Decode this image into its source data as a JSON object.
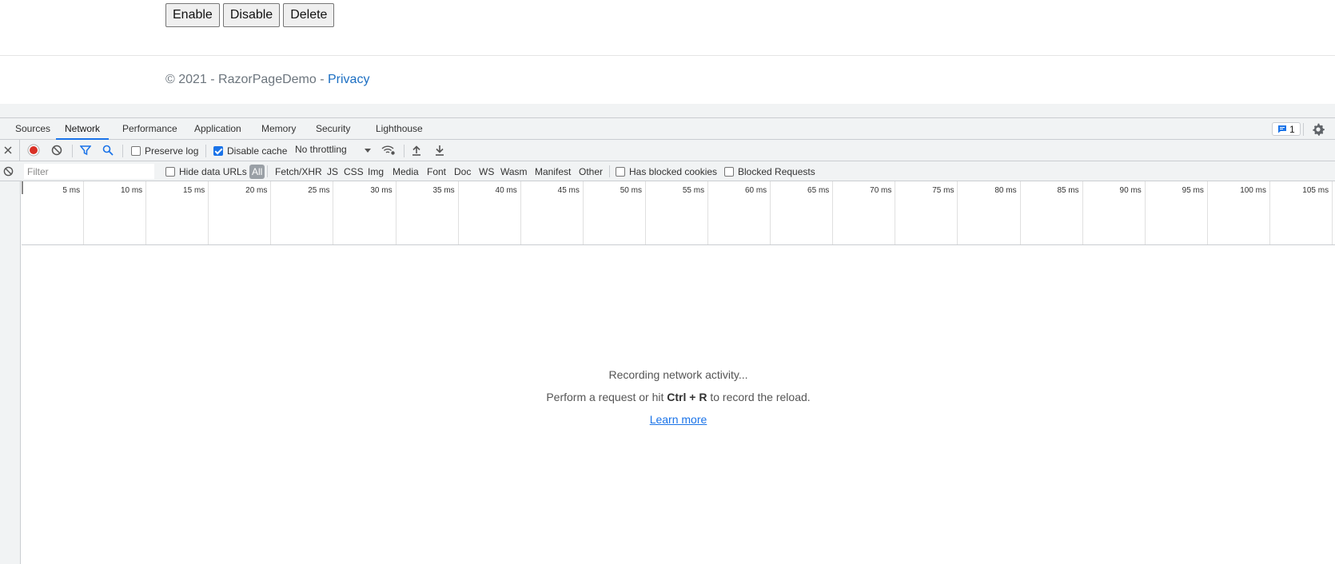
{
  "page": {
    "buttons": [
      "Enable",
      "Disable",
      "Delete"
    ],
    "footer": {
      "copyright": "© 2021 - RazorPageDemo - ",
      "privacy_link": "Privacy"
    }
  },
  "devtools": {
    "tabs": [
      {
        "label": "Sources",
        "active": false
      },
      {
        "label": "Network",
        "active": true
      },
      {
        "label": "Performance",
        "active": false
      },
      {
        "label": "Application",
        "active": false
      },
      {
        "label": "Memory",
        "active": false
      },
      {
        "label": "Security",
        "active": false
      },
      {
        "label": "Lighthouse",
        "active": false
      }
    ],
    "issues_count": "1",
    "toolbar": {
      "preserve_log": {
        "label": "Preserve log",
        "checked": false
      },
      "disable_cache": {
        "label": "Disable cache",
        "checked": true
      },
      "throttling": "No throttling"
    },
    "filter": {
      "placeholder": "Filter",
      "hide_data_urls": {
        "label": "Hide data URLs",
        "checked": false
      },
      "types": [
        "All",
        "Fetch/XHR",
        "JS",
        "CSS",
        "Img",
        "Media",
        "Font",
        "Doc",
        "WS",
        "Wasm",
        "Manifest",
        "Other"
      ],
      "selected_type": "All",
      "has_blocked_cookies": {
        "label": "Has blocked cookies",
        "checked": false
      },
      "blocked_requests": {
        "label": "Blocked Requests",
        "checked": false
      }
    },
    "timeline_ticks": [
      "5 ms",
      "10 ms",
      "15 ms",
      "20 ms",
      "25 ms",
      "30 ms",
      "35 ms",
      "40 ms",
      "45 ms",
      "50 ms",
      "55 ms",
      "60 ms",
      "65 ms",
      "70 ms",
      "75 ms",
      "80 ms",
      "85 ms",
      "90 ms",
      "95 ms",
      "100 ms",
      "105 ms"
    ],
    "empty_state": {
      "recording": "Recording network activity...",
      "hint_prefix": "Perform a request or hit ",
      "hint_keys": "Ctrl + R",
      "hint_suffix": " to record the reload.",
      "learn_more": "Learn more"
    },
    "colors": {
      "accent": "#1a73e8",
      "record": "#d93025"
    }
  }
}
